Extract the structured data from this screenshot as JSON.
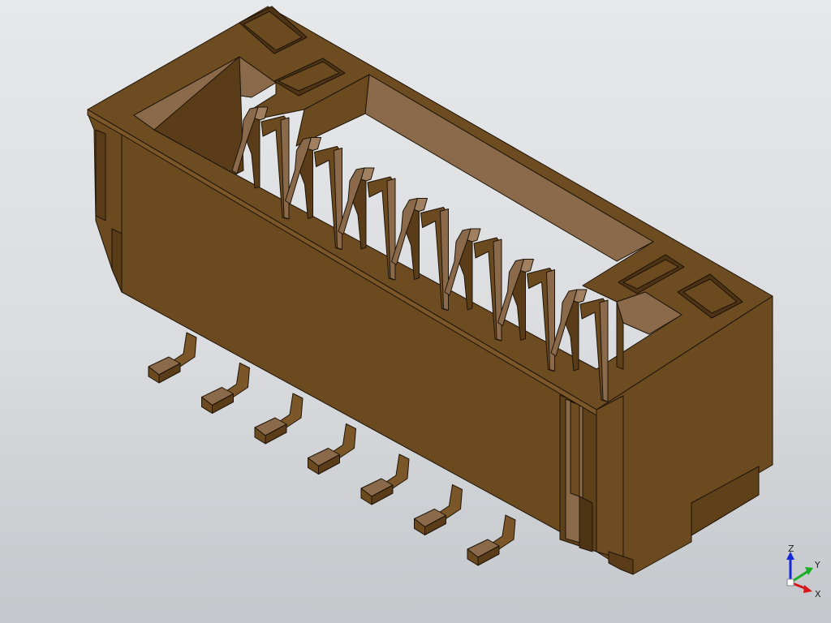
{
  "model": {
    "description_visible": false,
    "body_color": "#6b4a20",
    "top_color": "#6e4c22",
    "interior_color": "#8a6a4a",
    "dark_color": "#4e3414",
    "edge_color": "#1e1408"
  },
  "axis_triad": {
    "z_label": "Z",
    "y_label": "Y",
    "x_label": "X",
    "z_color": "#1428d8",
    "y_color": "#18b020",
    "x_color": "#d81818"
  }
}
